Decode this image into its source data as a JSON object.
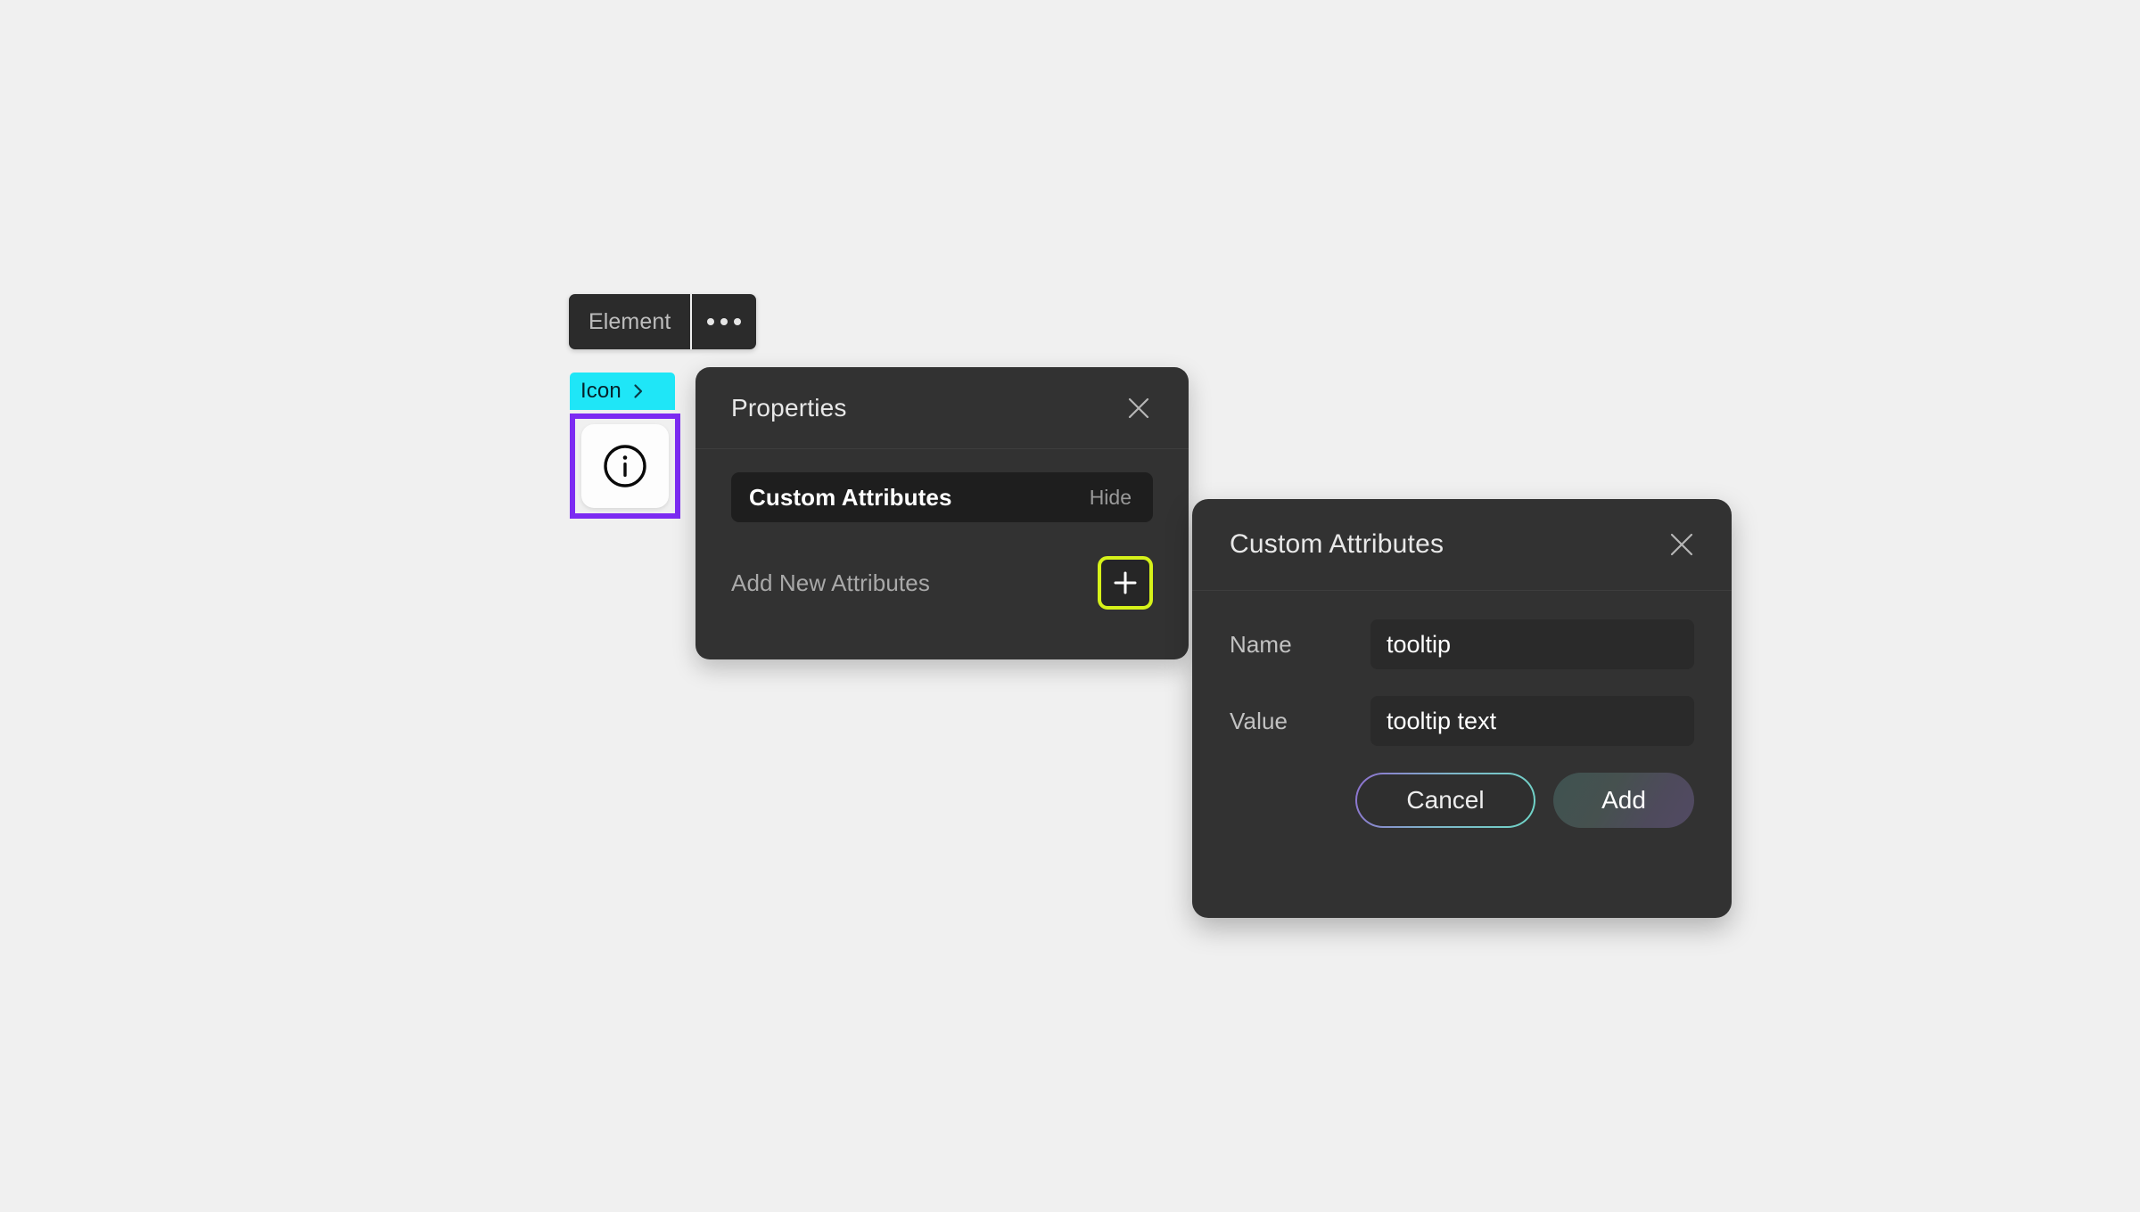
{
  "canvas": {
    "background_color": "#f0f0f0"
  },
  "element_toolbar": {
    "label": "Element",
    "more_icon": "ellipsis-icon",
    "background_color": "#2b2b2b"
  },
  "selection": {
    "badge_label": "Icon",
    "badge_color": "#1fe6f7",
    "badge_chevron_icon": "chevron-right-icon",
    "outline_color": "#7c2bf2",
    "element_icon": "info-circle-icon"
  },
  "properties_panel": {
    "title": "Properties",
    "close_icon": "close-icon",
    "attribute_row": {
      "name": "Custom Attributes",
      "action_label": "Hide"
    },
    "add_row": {
      "label": "Add New Attributes",
      "button_icon": "plus-icon",
      "button_accent_color": "#d6f219"
    }
  },
  "custom_attributes_dialog": {
    "title": "Custom Attributes",
    "close_icon": "close-icon",
    "fields": [
      {
        "label": "Name",
        "value": "tooltip"
      },
      {
        "label": "Value",
        "value": "tooltip text"
      }
    ],
    "buttons": {
      "cancel_label": "Cancel",
      "add_label": "Add"
    }
  }
}
